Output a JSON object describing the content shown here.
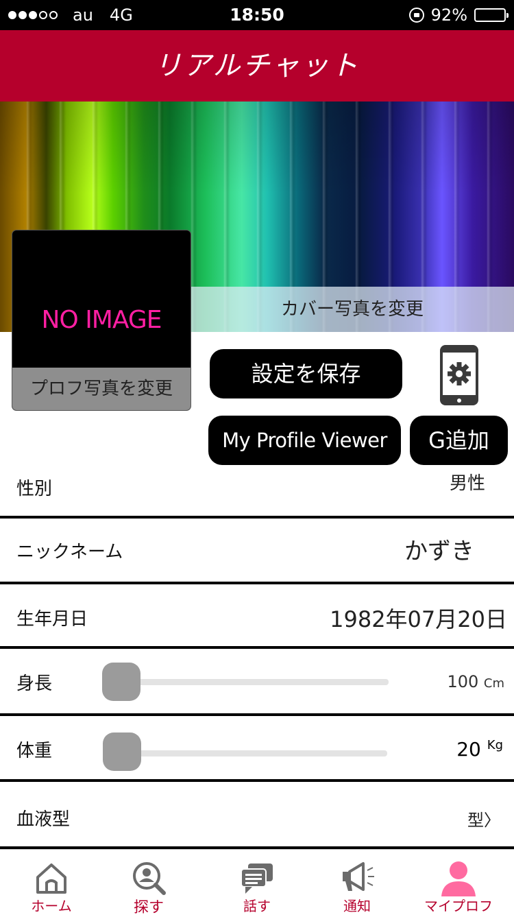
{
  "status_bar": {
    "carrier": "au",
    "network": "4G",
    "time": "18:50",
    "battery": "92%",
    "battery_level": 0.92
  },
  "header": {
    "title": "リアルチャット"
  },
  "cover": {
    "change_label": "カバー写真を変更"
  },
  "profile_photo": {
    "placeholder": "NO IMAGE",
    "change_label": "プロフ写真を変更"
  },
  "actions": {
    "save_label": "設定を保存",
    "viewer_label": "My Profile Viewer",
    "group_add_label": "G追加"
  },
  "fields": {
    "gender_label": "性別",
    "gender_value": "男性",
    "nickname_label": "ニックネーム",
    "nickname_value": "かずき",
    "birthday_label": "生年月日",
    "birthday_value": "1982年07月20日",
    "height_label": "身長",
    "height_value": "100",
    "height_unit": "Cm",
    "height_slider_level": 0,
    "weight_label": "体重",
    "weight_value": "20",
    "weight_unit": "Kg",
    "weight_slider_level": 0,
    "blood_label": "血液型",
    "blood_value": "型",
    "blood_chevron": "〉"
  },
  "tabbar": {
    "items": [
      {
        "label": "ホーム",
        "icon": "home-icon"
      },
      {
        "label": "探す",
        "icon": "search-user-icon"
      },
      {
        "label": "話す",
        "icon": "chat-icon"
      },
      {
        "label": "通知",
        "icon": "megaphone-icon"
      },
      {
        "label": "マイプロフ",
        "icon": "profile-icon"
      }
    ]
  },
  "colors": {
    "brand": "#b5002c",
    "active_tab_icon": "#ff6aa0",
    "inactive_tab_icon": "#6b6b6b",
    "no_image_text": "#ff1fa3"
  }
}
